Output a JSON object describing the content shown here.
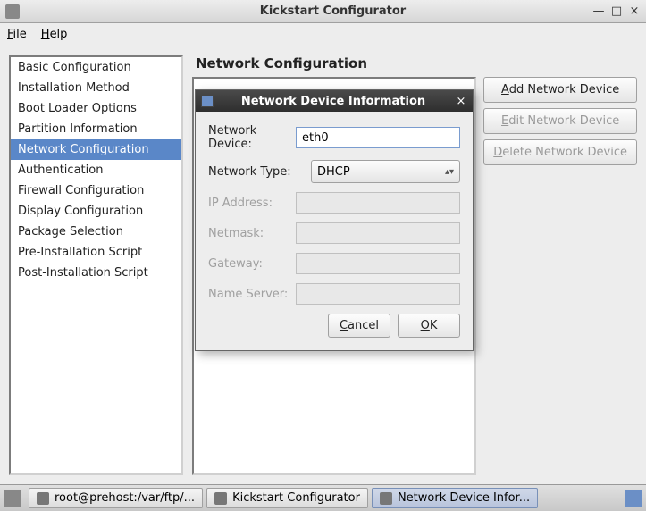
{
  "window": {
    "title": "Kickstart Configurator",
    "min": "—",
    "max": "□",
    "close": "×"
  },
  "menubar": {
    "file": "File",
    "help": "Help"
  },
  "sidebar": {
    "items": [
      "Basic Configuration",
      "Installation Method",
      "Boot Loader Options",
      "Partition Information",
      "Network Configuration",
      "Authentication",
      "Firewall Configuration",
      "Display Configuration",
      "Package Selection",
      "Pre-Installation Script",
      "Post-Installation Script"
    ],
    "selected_index": 4
  },
  "main": {
    "title": "Network Configuration",
    "buttons": {
      "add": "Add Network Device",
      "edit": "Edit Network Device",
      "delete": "Delete Network Device"
    }
  },
  "dialog": {
    "title": "Network Device Information",
    "close": "×",
    "fields": {
      "device_label": "Network Device:",
      "device_value": "eth0",
      "type_label": "Network Type:",
      "type_value": "DHCP",
      "ip_label": "IP Address:",
      "ip_value": "",
      "netmask_label": "Netmask:",
      "netmask_value": "",
      "gateway_label": "Gateway:",
      "gateway_value": "",
      "ns_label": "Name Server:",
      "ns_value": ""
    },
    "actions": {
      "cancel": "Cancel",
      "ok": "OK"
    }
  },
  "taskbar": {
    "items": [
      "root@prehost:/var/ftp/...",
      "Kickstart Configurator",
      "Network Device Infor..."
    ]
  }
}
